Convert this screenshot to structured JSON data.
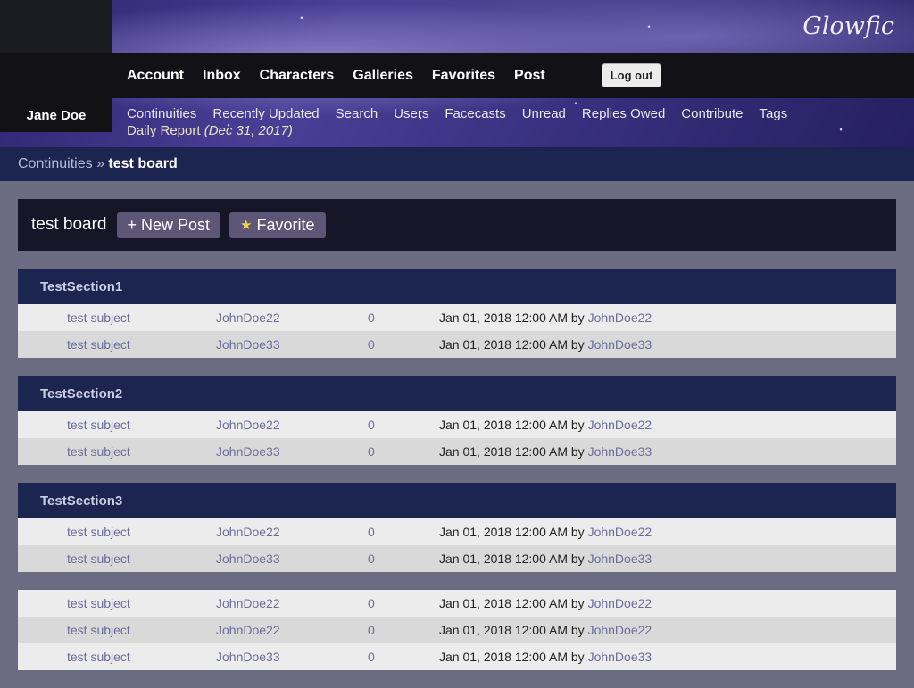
{
  "site": {
    "logo": "Glowfic"
  },
  "account_nav": {
    "links": [
      "Account",
      "Inbox",
      "Characters",
      "Galleries",
      "Favorites",
      "Post"
    ],
    "logout_label": "Log out"
  },
  "user": {
    "name": "Jane Doe"
  },
  "sub_nav": {
    "links": [
      "Continuities",
      "Recently Updated",
      "Search",
      "Users",
      "Facecasts",
      "Unread",
      "Replies Owed",
      "Contribute",
      "Tags"
    ],
    "daily_report_label": "Daily Report",
    "daily_report_date": "(Dec 31, 2017)"
  },
  "breadcrumb": {
    "parent": "Continuities",
    "separator": "»",
    "current": "test board"
  },
  "board": {
    "title": "test board",
    "new_post_label": "+ New Post",
    "favorite_label": "Favorite",
    "favorite_icon": "star-icon"
  },
  "sections": [
    {
      "title": "TestSection1",
      "posts": [
        {
          "subject": "test subject",
          "author": "JohnDoe22",
          "replies": "0",
          "updated": "Jan 01, 2018 12:00 AM",
          "by": "by",
          "last_user": "JohnDoe22"
        },
        {
          "subject": "test subject",
          "author": "JohnDoe33",
          "replies": "0",
          "updated": "Jan 01, 2018 12:00 AM",
          "by": "by",
          "last_user": "JohnDoe33"
        }
      ]
    },
    {
      "title": "TestSection2",
      "posts": [
        {
          "subject": "test subject",
          "author": "JohnDoe22",
          "replies": "0",
          "updated": "Jan 01, 2018 12:00 AM",
          "by": "by",
          "last_user": "JohnDoe22"
        },
        {
          "subject": "test subject",
          "author": "JohnDoe33",
          "replies": "0",
          "updated": "Jan 01, 2018 12:00 AM",
          "by": "by",
          "last_user": "JohnDoe33"
        }
      ]
    },
    {
      "title": "TestSection3",
      "posts": [
        {
          "subject": "test subject",
          "author": "JohnDoe22",
          "replies": "0",
          "updated": "Jan 01, 2018 12:00 AM",
          "by": "by",
          "last_user": "JohnDoe22"
        },
        {
          "subject": "test subject",
          "author": "JohnDoe33",
          "replies": "0",
          "updated": "Jan 01, 2018 12:00 AM",
          "by": "by",
          "last_user": "JohnDoe33"
        }
      ]
    }
  ],
  "unsectioned": {
    "posts": [
      {
        "subject": "test subject",
        "author": "JohnDoe22",
        "replies": "0",
        "updated": "Jan 01, 2018 12:00 AM",
        "by": "by",
        "last_user": "JohnDoe22"
      },
      {
        "subject": "test subject",
        "author": "JohnDoe22",
        "replies": "0",
        "updated": "Jan 01, 2018 12:00 AM",
        "by": "by",
        "last_user": "JohnDoe22"
      },
      {
        "subject": "test subject",
        "author": "JohnDoe33",
        "replies": "0",
        "updated": "Jan 01, 2018 12:00 AM",
        "by": "by",
        "last_user": "JohnDoe33"
      }
    ]
  },
  "colors": {
    "section_header": "#1b2550",
    "row_light": "#ececec",
    "row_dark": "#d9d9d9",
    "link": "#6c6d9b",
    "page_background": "#6b6b82"
  }
}
